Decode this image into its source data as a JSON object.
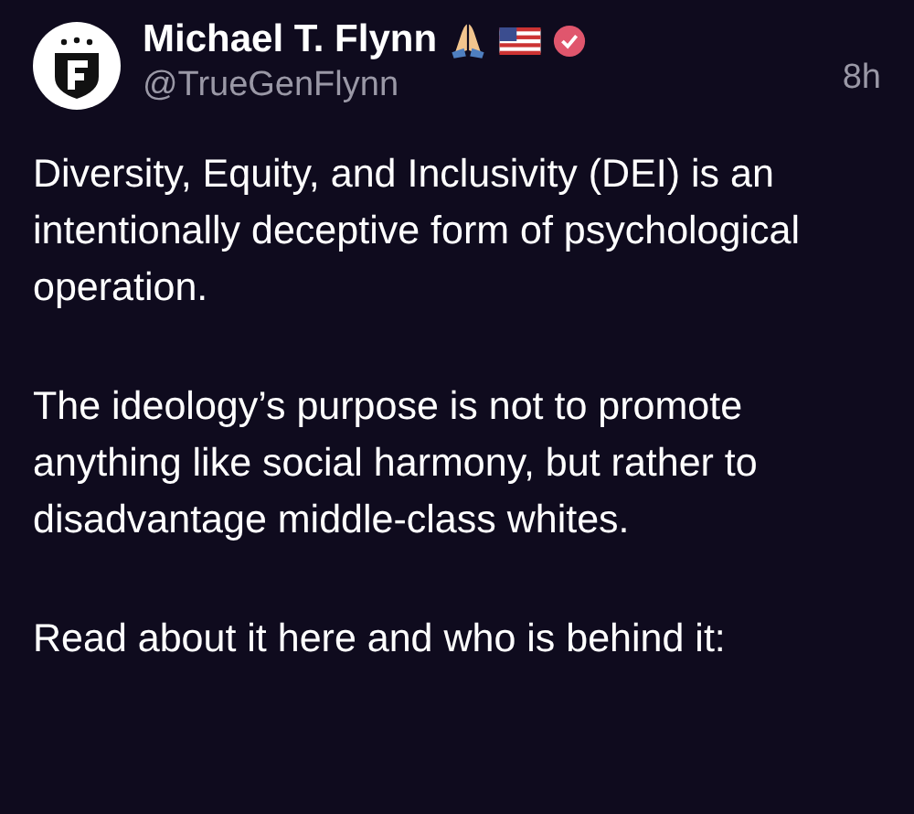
{
  "post": {
    "author": "Michael T. Flynn",
    "handle": "@TrueGenFlynn",
    "time": "8h",
    "verified": true,
    "paragraphs": [
      "Diversity, Equity, and Inclusivity (DEI) is an intentionally deceptive form of psychological operation.",
      "The ideology’s purpose is not to promote anything like social harmony, but rather to disadvantage middle-class whites.",
      "Read about it here and who is behind it:"
    ]
  }
}
